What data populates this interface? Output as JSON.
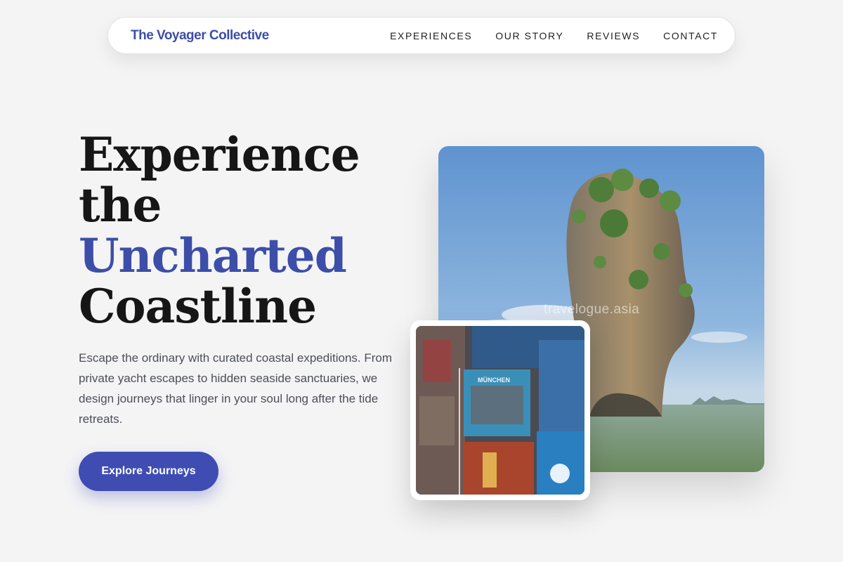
{
  "nav": {
    "brand": "The Voyager Collective",
    "links": [
      "EXPERIENCES",
      "OUR STORY",
      "REVIEWS",
      "CONTACT"
    ]
  },
  "hero": {
    "title_lines": [
      "Experience",
      "the",
      "Uncharted",
      "Coastline"
    ],
    "description": "Escape the ordinary with curated coastal expeditions. From private yacht escapes to hidden seaside sanctuaries, we design journeys that linger in your soul long after the tide retreats.",
    "cta_label": "Explore Journeys"
  },
  "images": {
    "main_watermark": "travelogue.asia",
    "postcard_label": "MÜNCHEN"
  },
  "colors": {
    "accent": "#3d4ea8",
    "button": "#3f4db3",
    "background": "#f4f4f5"
  }
}
